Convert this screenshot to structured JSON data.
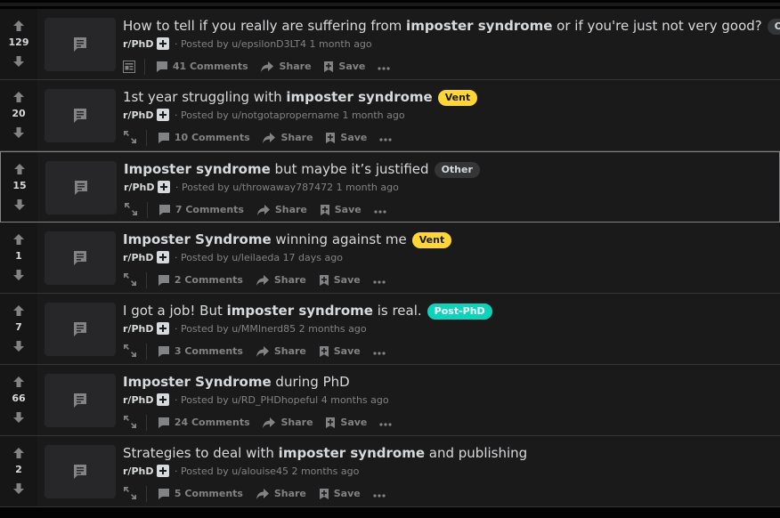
{
  "colors": {
    "other": "#343536",
    "vent": "#ffd635",
    "postphd": "#0dd3bb"
  },
  "icons": {
    "upvote": "upvote-arrow-icon",
    "downvote": "downvote-arrow-icon",
    "thumb": "text-post-icon",
    "comments": "comment-icon",
    "share": "share-icon",
    "save": "save-icon",
    "more": "more-dots-icon",
    "expand": "expand-icon",
    "text_preview": "text-preview-icon"
  },
  "posts": [
    {
      "votes": "129",
      "title_pre": "How to tell if you really are suffering from ",
      "title_hl": "imposter syndrome",
      "title_post": " or if you're just not very good?",
      "flair": "Other",
      "flair_type": "other",
      "subreddit": "r/PhD",
      "posted_by": "· Posted by u/epsilonD3LT4",
      "time": "1 month ago",
      "comments": "41 Comments",
      "share": "Share",
      "save": "Save",
      "expand_kind": "text"
    },
    {
      "votes": "20",
      "title_pre": "1st year struggling with ",
      "title_hl": "imposter syndrome",
      "title_post": "",
      "flair": "Vent",
      "flair_type": "vent",
      "subreddit": "r/PhD",
      "posted_by": "· Posted by u/notgotapropername",
      "time": "1 month ago",
      "comments": "10 Comments",
      "share": "Share",
      "save": "Save",
      "expand_kind": "expand"
    },
    {
      "votes": "15",
      "title_pre": "",
      "title_hl": "Imposter syndrome",
      "title_post": " but maybe it’s justified",
      "flair": "Other",
      "flair_type": "other",
      "subreddit": "r/PhD",
      "posted_by": "· Posted by u/throwaway787472",
      "time": "1 month ago",
      "comments": "7 Comments",
      "share": "Share",
      "save": "Save",
      "expand_kind": "expand",
      "selected": true
    },
    {
      "votes": "1",
      "title_pre": "",
      "title_hl": "Imposter Syndrome",
      "title_post": " winning against me",
      "flair": "Vent",
      "flair_type": "vent",
      "subreddit": "r/PhD",
      "posted_by": "· Posted by u/leilaeda",
      "time": "17 days ago",
      "comments": "2 Comments",
      "share": "Share",
      "save": "Save",
      "expand_kind": "expand"
    },
    {
      "votes": "7",
      "title_pre": "I got a job! But ",
      "title_hl": "imposter syndrome",
      "title_post": " is real.",
      "flair": "Post-PhD",
      "flair_type": "postphd",
      "subreddit": "r/PhD",
      "posted_by": "· Posted by u/MMInerd85",
      "time": "2 months ago",
      "comments": "3 Comments",
      "share": "Share",
      "save": "Save",
      "expand_kind": "expand"
    },
    {
      "votes": "66",
      "title_pre": "",
      "title_hl": "Imposter Syndrome",
      "title_post": " during PhD",
      "flair": "",
      "flair_type": "",
      "subreddit": "r/PhD",
      "posted_by": "· Posted by u/RD_PHDhopeful",
      "time": "4 months ago",
      "comments": "24 Comments",
      "share": "Share",
      "save": "Save",
      "expand_kind": "expand"
    },
    {
      "votes": "2",
      "title_pre": "Strategies to deal with ",
      "title_hl": "imposter syndrome",
      "title_post": " and publishing",
      "flair": "",
      "flair_type": "",
      "subreddit": "r/PhD",
      "posted_by": "· Posted by u/alouise45",
      "time": "2 months ago",
      "comments": "5 Comments",
      "share": "Share",
      "save": "Save",
      "expand_kind": "expand"
    }
  ]
}
